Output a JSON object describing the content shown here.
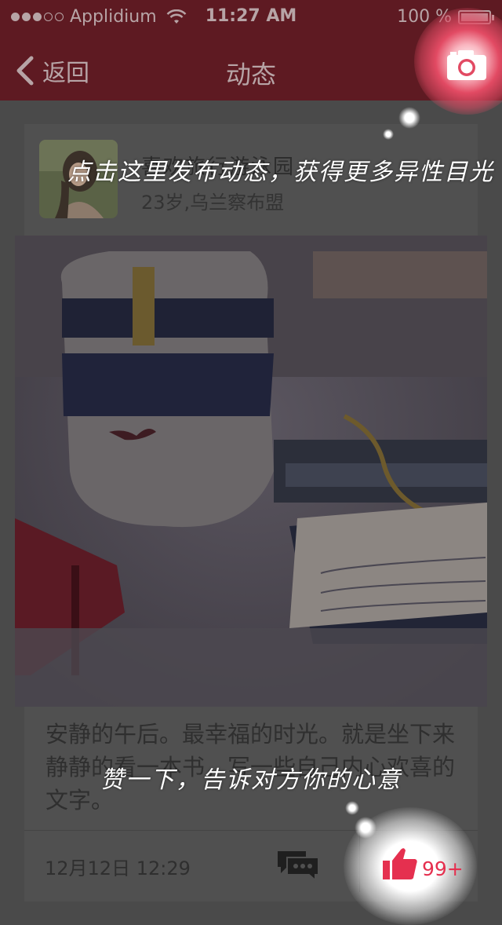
{
  "status_bar": {
    "carrier": "Applidium",
    "time": "11:27 AM",
    "battery": "100 %"
  },
  "nav": {
    "back_label": "返回",
    "title": "动态",
    "camera_icon": "camera-icon"
  },
  "post": {
    "user_name": "喜欢旅行游泳园",
    "user_info": "23岁,乌兰察布盟",
    "text": "安静的午后。最幸福的时光。就是坐下来静静的看一本书，写一些自己内心欢喜的文字。",
    "date": "12月12日 12:29",
    "comment_icon": "chat-bubbles-icon",
    "like_icon": "thumbs-up-icon",
    "like_count": "99+"
  },
  "guide": {
    "hint_camera": "点击这里发布动态，获得更多异性目光",
    "hint_like": "赞一下，告诉对方你的心意"
  },
  "colors": {
    "nav_bg": "#5e1a22",
    "accent": "#e5304f"
  }
}
